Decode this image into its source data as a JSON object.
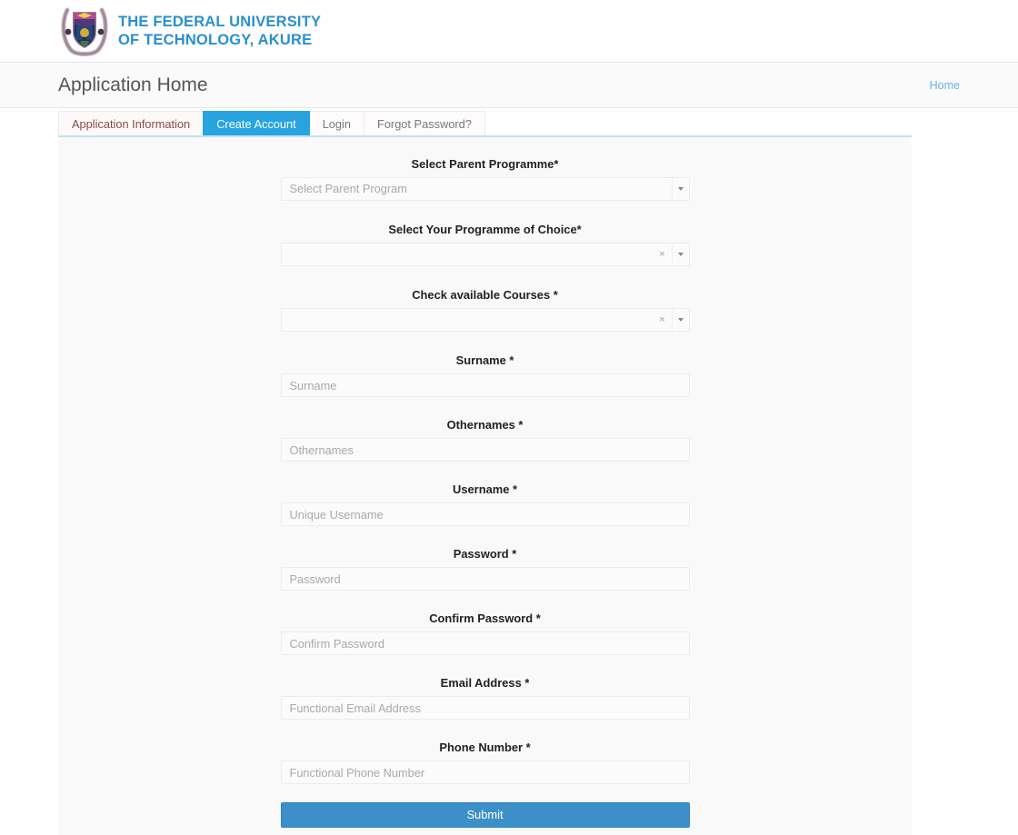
{
  "brand": {
    "logo_icon": "university-crest-logo",
    "line1": "THE FEDERAL UNIVERSITY",
    "line2": "OF TECHNOLOGY, AKURE",
    "color": "#2a8fd0"
  },
  "header": {
    "title": "Application Home",
    "breadcrumb": "Home",
    "breadcrumb_color": "#68b4e0"
  },
  "tabs": [
    {
      "label": "Application Information",
      "active": false
    },
    {
      "label": "Create Account",
      "active": true
    },
    {
      "label": "Login",
      "active": false
    },
    {
      "label": "Forgot Password?",
      "active": false
    }
  ],
  "active_tab_color": "#27a4e0",
  "form": {
    "fields": [
      {
        "name": "parent-programme",
        "label": "Select Parent Programme*",
        "type": "select2",
        "value": "",
        "placeholder": "Select Parent Program",
        "has_clear": false
      },
      {
        "name": "programme-of-choice",
        "label": "Select Your Programme of Choice*",
        "type": "select2",
        "value": "",
        "placeholder": "",
        "has_clear": true
      },
      {
        "name": "available-courses",
        "label": "Check available Courses *",
        "type": "select2",
        "value": "",
        "placeholder": "",
        "has_clear": true
      },
      {
        "name": "surname",
        "label": "Surname *",
        "type": "text",
        "value": "",
        "placeholder": "Surname"
      },
      {
        "name": "othernames",
        "label": "Othernames *",
        "type": "text",
        "value": "",
        "placeholder": "Othernames"
      },
      {
        "name": "username",
        "label": "Username *",
        "type": "text",
        "value": "",
        "placeholder": "Unique Username"
      },
      {
        "name": "password",
        "label": "Password *",
        "type": "password",
        "value": "",
        "placeholder": "Password"
      },
      {
        "name": "confirm-password",
        "label": "Confirm Password *",
        "type": "password",
        "value": "",
        "placeholder": "Confirm Password"
      },
      {
        "name": "email-address",
        "label": "Email Address *",
        "type": "text",
        "value": "",
        "placeholder": "Functional Email Address"
      },
      {
        "name": "phone-number",
        "label": "Phone Number *",
        "type": "text",
        "value": "",
        "placeholder": "Functional Phone Number"
      }
    ],
    "submit_label": "Submit",
    "submit_color": "#3d8fc9",
    "clear_icon": "×"
  }
}
